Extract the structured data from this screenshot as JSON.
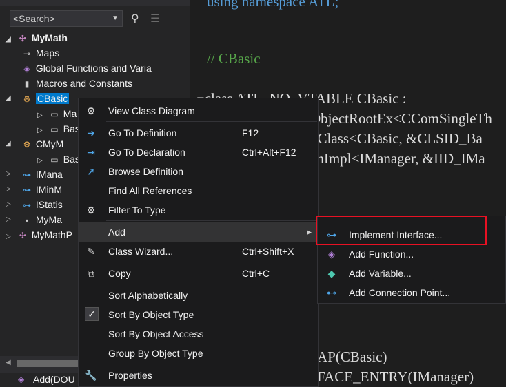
{
  "search": {
    "placeholder": "<Search>"
  },
  "tree": [
    {
      "label": "MyMath",
      "icon": "namespace-icon"
    },
    {
      "label": "Maps",
      "icon": "map-icon"
    },
    {
      "label": "Global Functions and Varia",
      "icon": "globals-icon"
    },
    {
      "label": "Macros and Constants",
      "icon": "macro-icon"
    },
    {
      "label": "CBasic",
      "icon": "class-icon"
    },
    {
      "label": "Ma",
      "icon": "folder-icon"
    },
    {
      "label": "Bas",
      "icon": "folder-icon"
    },
    {
      "label": "CMyM",
      "icon": "class-icon"
    },
    {
      "label": "Bas",
      "icon": "folder-icon"
    },
    {
      "label": "IMana",
      "icon": "interface-icon"
    },
    {
      "label": "IMinM",
      "icon": "interface-icon"
    },
    {
      "label": "IStatis",
      "icon": "interface-icon"
    },
    {
      "label": "MyMa",
      "icon": "struct-icon"
    },
    {
      "label": "MyMathP",
      "icon": "namespace-icon"
    }
  ],
  "bottom_item": "Add(DOU",
  "code": {
    "line1": "using namespace ATL;",
    "line2": "// CBasic",
    "line3": "class ATL_NO_VTABLE CBasic :",
    "line4": "ObjectRootEx<CComSingleTh",
    "line5": "oClass<CBasic, &CLSID_Ba",
    "line6": "chImpl<IManager, &IID_IMa",
    "line7": "AP(CBasic)",
    "line8": "FACE_ENTRY(IManager)"
  },
  "context_menu": {
    "items": [
      {
        "label": "View Class Diagram",
        "shortcut": ""
      },
      {
        "label": "Go To Definition",
        "shortcut": "F12"
      },
      {
        "label": "Go To Declaration",
        "shortcut": "Ctrl+Alt+F12"
      },
      {
        "label": "Browse Definition",
        "shortcut": ""
      },
      {
        "label": "Find All References",
        "shortcut": ""
      },
      {
        "label": "Filter To Type",
        "shortcut": ""
      },
      {
        "label": "Add",
        "shortcut": ""
      },
      {
        "label": "Class Wizard...",
        "shortcut": "Ctrl+Shift+X"
      },
      {
        "label": "Copy",
        "shortcut": "Ctrl+C"
      },
      {
        "label": "Sort Alphabetically",
        "shortcut": ""
      },
      {
        "label": "Sort By Object Type",
        "shortcut": ""
      },
      {
        "label": "Sort By Object Access",
        "shortcut": ""
      },
      {
        "label": "Group By Object Type",
        "shortcut": ""
      },
      {
        "label": "Properties",
        "shortcut": ""
      }
    ]
  },
  "submenu": {
    "items": [
      {
        "label": "Implement Interface..."
      },
      {
        "label": "Add Function..."
      },
      {
        "label": "Add Variable..."
      },
      {
        "label": "Add Connection Point..."
      }
    ]
  },
  "colors": {
    "accent": "#007acc",
    "highlight_border": "#e81123"
  }
}
